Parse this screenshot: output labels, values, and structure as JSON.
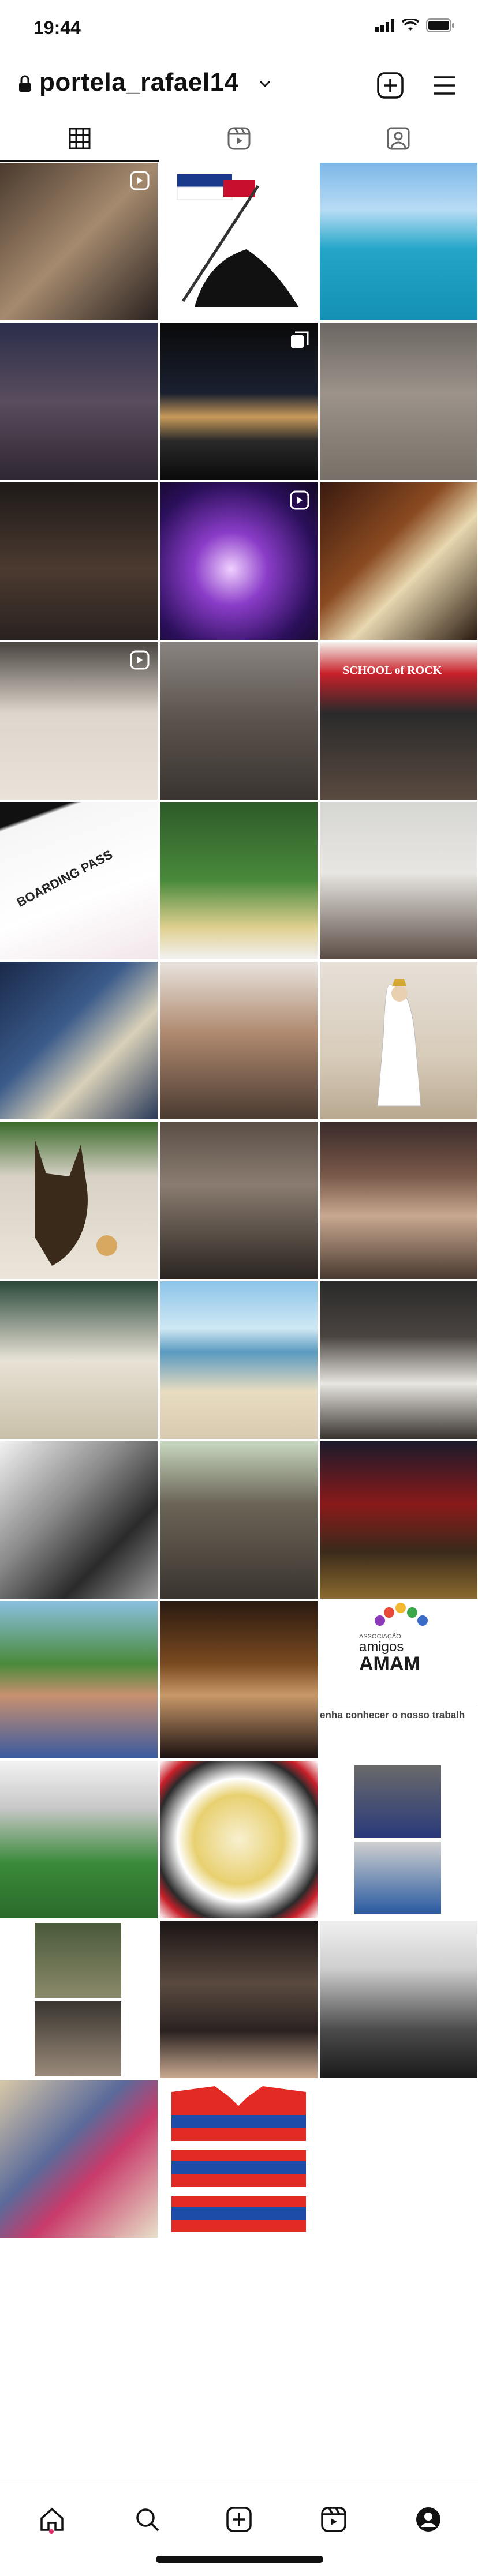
{
  "status_bar": {
    "time": "19:44"
  },
  "profile": {
    "username": "portela_rafael14"
  },
  "tabs": [
    {
      "name": "grid",
      "label": "Posts"
    },
    {
      "name": "reels",
      "label": "Reels"
    },
    {
      "name": "tagged",
      "label": "Tagged"
    }
  ],
  "grid_texts": {
    "amam_assoc": "ASSOCIAÇÃO",
    "amam_amigos": "amigos",
    "amam_name": "AMAM",
    "amam_caption": "enha conhecer o nosso trabalh",
    "school_sign": "SCHOOL of ROCK",
    "boarding": "BOARDING PASS"
  },
  "bottom_nav": [
    {
      "name": "home"
    },
    {
      "name": "search"
    },
    {
      "name": "create"
    },
    {
      "name": "reels"
    },
    {
      "name": "profile"
    }
  ],
  "colors": {
    "accent": "#e1306c",
    "text": "#111111"
  }
}
